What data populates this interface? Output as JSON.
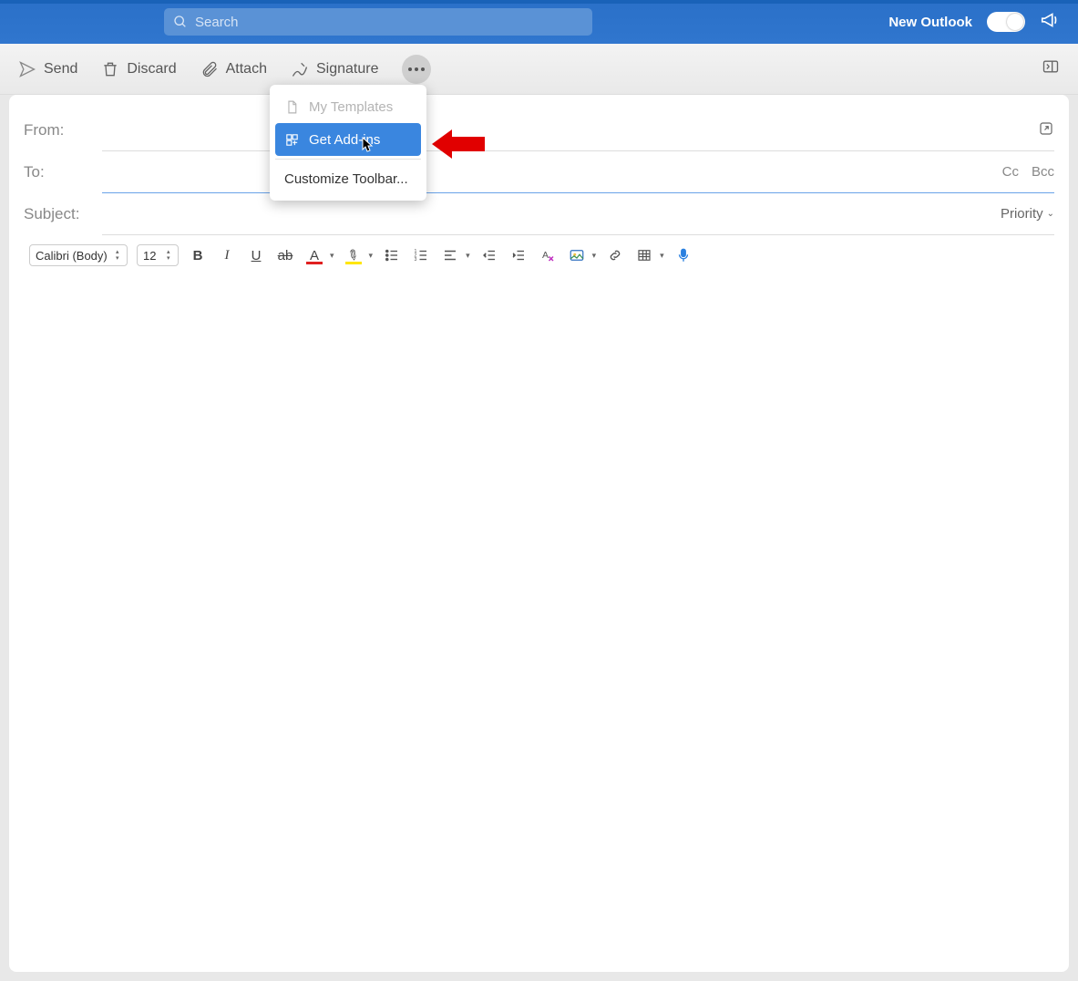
{
  "header": {
    "search_placeholder": "Search",
    "new_outlook_label": "New Outlook"
  },
  "toolbar": {
    "send": "Send",
    "discard": "Discard",
    "attach": "Attach",
    "signature": "Signature"
  },
  "menu": {
    "my_templates": "My Templates",
    "get_addins": "Get Add-ins",
    "customize": "Customize Toolbar..."
  },
  "fields": {
    "from": "From:",
    "to": "To:",
    "subject": "Subject:",
    "cc": "Cc",
    "bcc": "Bcc",
    "priority": "Priority"
  },
  "format": {
    "font": "Calibri (Body)",
    "size": "12"
  }
}
